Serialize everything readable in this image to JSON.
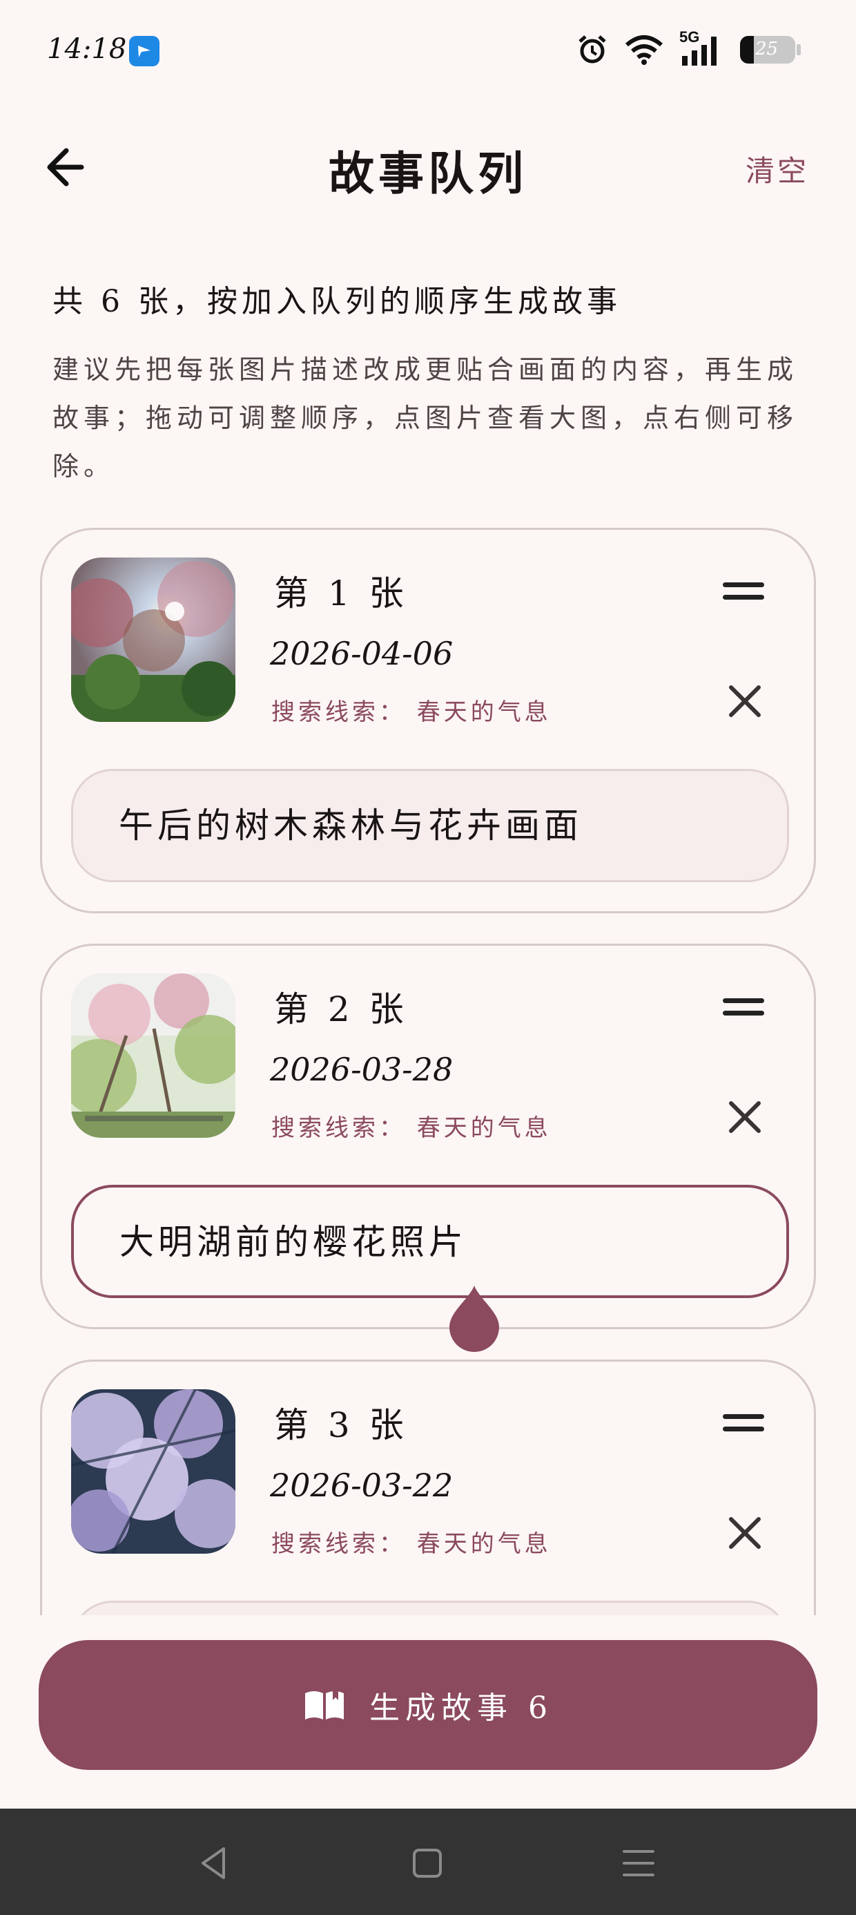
{
  "status_bar": {
    "time": "14:18",
    "app_icon": "feishu-icon",
    "icons": [
      "alarm-icon",
      "wifi-icon",
      "5g-signal-icon"
    ],
    "network": "5G",
    "battery": "25"
  },
  "header": {
    "back_icon": "arrow-left-icon",
    "title": "故事队列",
    "clear_label": "清空"
  },
  "intro": {
    "summary": "共 6 张，按加入队列的顺序生成故事",
    "hint": "建议先把每张图片描述改成更贴合画面的内容，再生成故事；拖动可调整顺序，点图片查看大图，点右侧可移除。"
  },
  "queue": [
    {
      "index_label": "第 1 张",
      "date": "2026-04-06",
      "clue": "搜索线索： 春天的气息",
      "description": "午后的树木森林与花卉画面",
      "editing": false
    },
    {
      "index_label": "第 2 张",
      "date": "2026-03-28",
      "clue": "搜索线索： 春天的气息",
      "description": "大明湖前的樱花照片",
      "editing": true
    },
    {
      "index_label": "第 3 张",
      "date": "2026-03-22",
      "clue": "搜索线索： 春天的气息",
      "description": "",
      "editing": false
    }
  ],
  "generate_button": {
    "icon": "book-open-icon",
    "label": "生成故事 6"
  },
  "nav_bar": {
    "items": [
      "back-triangle-icon",
      "home-square-icon",
      "menu-lines-icon"
    ]
  },
  "colors": {
    "accent": "#8b4a5e",
    "background": "#fcf6f5",
    "nav_bar": "#333333"
  }
}
